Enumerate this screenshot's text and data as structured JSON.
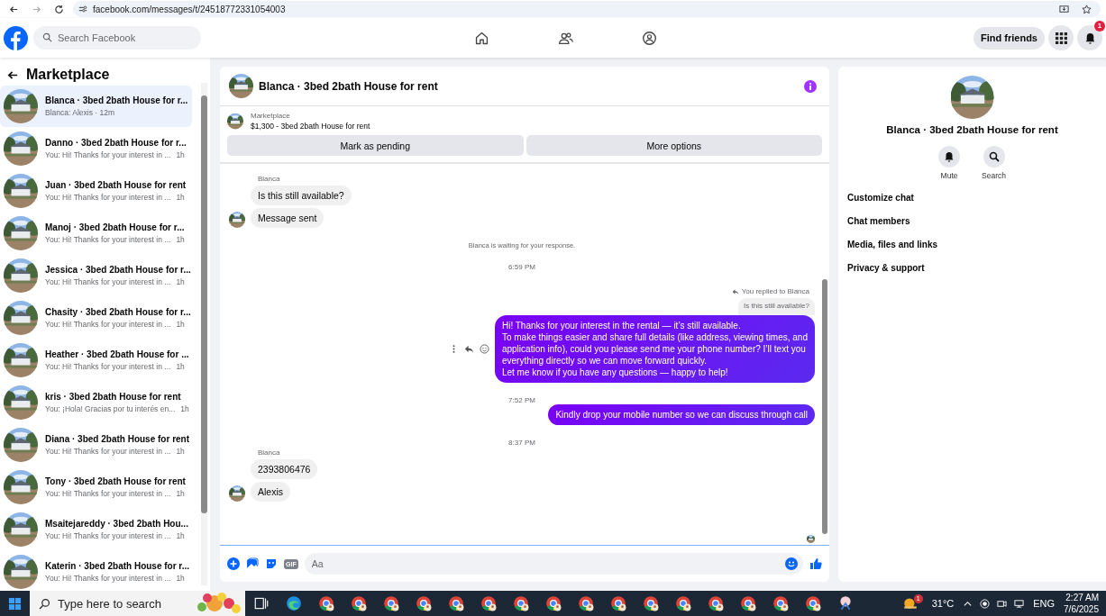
{
  "browser": {
    "url": "facebook.com/messages/t/24518772331054003"
  },
  "header": {
    "search_placeholder": "Search Facebook",
    "find_friends": "Find friends",
    "notification_count": "1"
  },
  "sidebar": {
    "title": "Marketplace",
    "conversations": [
      {
        "title": "Blanca · 3bed 2bath House for r...",
        "preview": "Blanca: Alexis · 12m",
        "selected": true
      },
      {
        "title": "Danno · 3bed 2bath House for r...",
        "preview": "You: Hi! Thanks for your interest in ...",
        "time": "1h",
        "selected": false
      },
      {
        "title": "Juan · 3bed 2bath House for rent",
        "preview": "You: Hi! Thanks for your interest in ...",
        "time": "1h",
        "selected": false
      },
      {
        "title": "Manoj · 3bed 2bath House for r...",
        "preview": "You: Hi! Thanks for your interest in ...",
        "time": "1h",
        "selected": false
      },
      {
        "title": "Jessica · 3bed 2bath House for r...",
        "preview": "You: Hi! Thanks for your interest in ...",
        "time": "1h",
        "selected": false
      },
      {
        "title": "Chasity · 3bed 2bath House for r...",
        "preview": "You: Hi! Thanks for your interest in ...",
        "time": "1h",
        "selected": false
      },
      {
        "title": "Heather · 3bed 2bath House for ...",
        "preview": "You: Hi! Thanks for your interest in ...",
        "time": "1h",
        "selected": false
      },
      {
        "title": "kris · 3bed 2bath House for rent",
        "preview": "You: ¡Hola! Gracias por tu interés en...",
        "time": "1h",
        "selected": false
      },
      {
        "title": "Diana · 3bed 2bath House for rent",
        "preview": "You: Hi! Thanks for your interest in ...",
        "time": "1h",
        "selected": false
      },
      {
        "title": "Tony · 3bed 2bath House for rent",
        "preview": "You: Hi! Thanks for your interest in ...",
        "time": "1h",
        "selected": false
      },
      {
        "title": "Msaitejareddy · 3bed 2bath Hou...",
        "preview": "You: Hi! Thanks for your interest in ...",
        "time": "1h",
        "selected": false
      },
      {
        "title": "Katerin · 3bed 2bath House for r...",
        "preview": "You: Hi! Thanks for your interest in ...",
        "time": "1h",
        "selected": false
      }
    ]
  },
  "chat": {
    "title": "Blanca · 3bed 2bath House for rent",
    "listing": {
      "label": "Marketplace",
      "text": "$1,300 - 3bed 2bath House for rent"
    },
    "buttons": [
      "Mark as pending",
      "More options"
    ],
    "messages": [
      {
        "kind": "sender",
        "text": "Blanca"
      },
      {
        "kind": "incoming",
        "text": "Is this still available?",
        "avatar": false
      },
      {
        "kind": "incoming",
        "text": "Message sent",
        "avatar": true
      },
      {
        "kind": "notice",
        "text": "Blanca is waiting for your response."
      },
      {
        "kind": "time",
        "text": "6:59 PM"
      },
      {
        "kind": "reply_note",
        "text": "You replied to Blanca"
      },
      {
        "kind": "quote",
        "text": "Is this still available?"
      },
      {
        "kind": "outgoing",
        "text": "Hi! Thanks for your interest in the rental — it’s still available.\nTo make things easier and share full details (like address, viewing times, and\napplication info), could you please send me your phone number? I’ll text you\neverything directly so we can move forward quickly.\nLet me know if you have any questions — happy to help!",
        "actions": true
      },
      {
        "kind": "time",
        "text": "7:52 PM"
      },
      {
        "kind": "outgoing",
        "text": "Kindly drop your mobile number so we can discuss through call",
        "actions": false
      },
      {
        "kind": "time",
        "text": "8:37 PM"
      },
      {
        "kind": "sender",
        "text": "Blanca"
      },
      {
        "kind": "incoming",
        "text": "2393806476",
        "avatar": false
      },
      {
        "kind": "incoming",
        "text": "Alexis",
        "avatar": true
      }
    ],
    "composer": {
      "gif": "GIF",
      "placeholder": "Aa"
    }
  },
  "details": {
    "title": "Blanca · 3bed 2bath House for rent",
    "actions": [
      {
        "kind": "mute",
        "label": "Mute"
      },
      {
        "kind": "search",
        "label": "Search"
      }
    ],
    "items": [
      "Customize chat",
      "Chat members",
      "Media, files and links",
      "Privacy & support"
    ]
  },
  "taskbar": {
    "search_placeholder": "Type here to search",
    "weather_badge": "1",
    "temperature": "31°C",
    "language": "ENG",
    "time": "2:27 AM",
    "date": "7/6/2025"
  }
}
